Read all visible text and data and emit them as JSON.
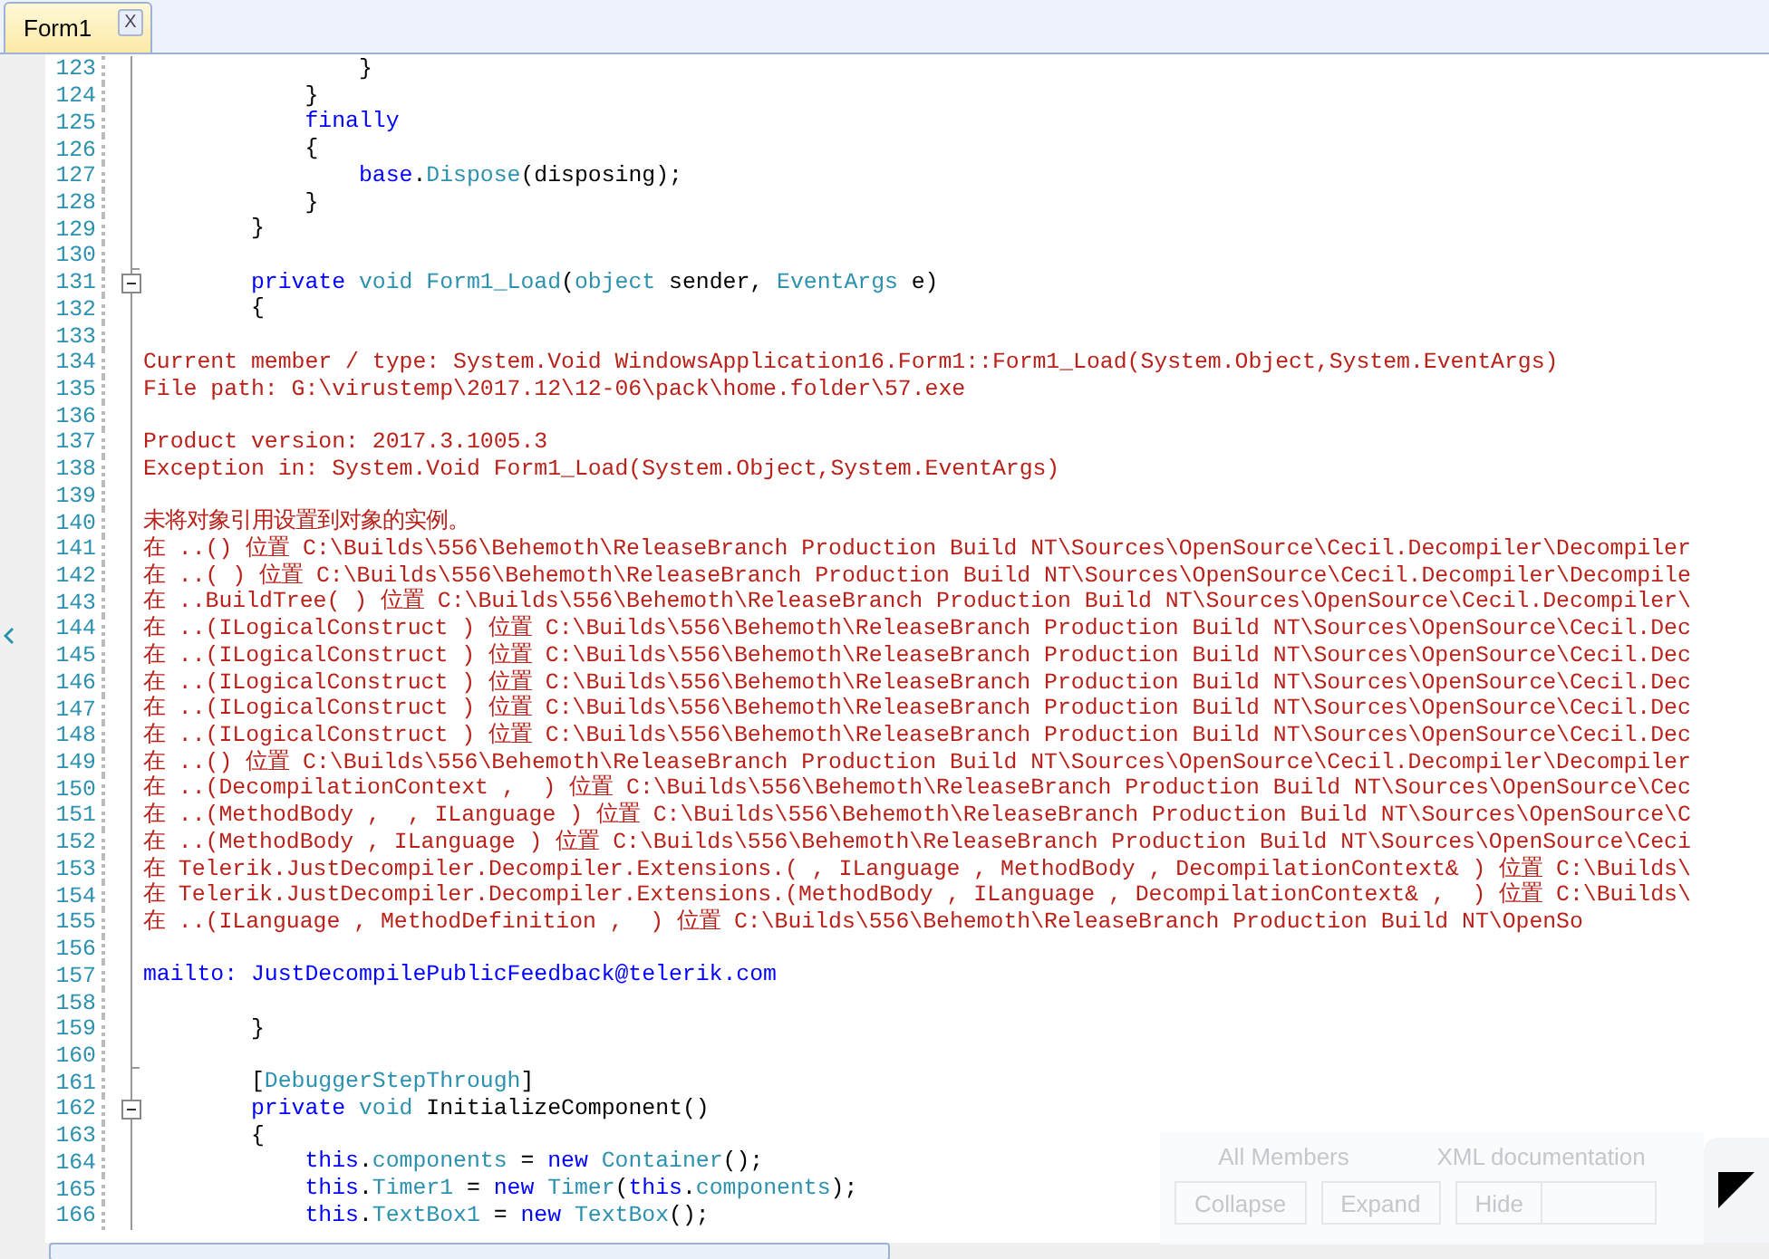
{
  "tabs": [
    {
      "label": "Form1",
      "selected": true,
      "close": "X"
    }
  ],
  "lines": [
    {
      "number": "123",
      "segments": [
        {
          "kind": "text",
          "text": "                }"
        }
      ]
    },
    {
      "number": "124",
      "segments": [
        {
          "kind": "text",
          "text": "            }"
        }
      ]
    },
    {
      "number": "125",
      "segments": [
        {
          "kind": "keyword",
          "text": "            finally"
        }
      ]
    },
    {
      "number": "126",
      "segments": [
        {
          "kind": "text",
          "text": "            {"
        }
      ]
    },
    {
      "number": "127",
      "segments": [
        {
          "kind": "keyword",
          "text": "                base"
        },
        {
          "kind": "text",
          "text": "."
        },
        {
          "kind": "type",
          "text": "Dispose"
        },
        {
          "kind": "text",
          "text": "(disposing);"
        }
      ]
    },
    {
      "number": "128",
      "segments": [
        {
          "kind": "text",
          "text": "            }"
        }
      ]
    },
    {
      "number": "129",
      "segments": [
        {
          "kind": "text",
          "text": "        }"
        }
      ]
    },
    {
      "number": "130",
      "kind": "foldend"
    },
    {
      "number": "131",
      "kind": "foldstart",
      "expanded": true,
      "segments": [
        {
          "kind": "keyword",
          "text": "        private"
        },
        {
          "kind": "type",
          "text": " void Form1_Load"
        },
        {
          "kind": "text",
          "text": "("
        },
        {
          "kind": "type",
          "text": "object"
        },
        {
          "kind": "text",
          "text": " sender, "
        },
        {
          "kind": "type",
          "text": "EventArgs"
        },
        {
          "kind": "text",
          "text": " e)"
        }
      ]
    },
    {
      "number": "132",
      "segments": [
        {
          "kind": "text",
          "text": "        {"
        }
      ]
    },
    {
      "number": "133"
    },
    {
      "number": "134",
      "segments": [
        {
          "kind": "message",
          "text": "Current member / type: System.Void WindowsApplication16.Form1::Form1_Load(System.Object,System.EventArgs)"
        }
      ]
    },
    {
      "number": "135",
      "segments": [
        {
          "kind": "message",
          "text": "File path: G:\\virustemp\\2017.12\\12-06\\pack\\home.folder\\57.exe"
        }
      ]
    },
    {
      "number": "136"
    },
    {
      "number": "137",
      "segments": [
        {
          "kind": "message",
          "text": "Product version: 2017.3.1005.3"
        }
      ]
    },
    {
      "number": "138",
      "segments": [
        {
          "kind": "message",
          "text": "Exception in: System.Void Form1_Load(System.Object,System.EventArgs)"
        }
      ]
    },
    {
      "number": "139"
    },
    {
      "number": "140",
      "segments": [
        {
          "kind": "message",
          "text": "未将对象引用设置到对象的实例。"
        }
      ]
    },
    {
      "number": "141",
      "segments": [
        {
          "kind": "message",
          "text": "在 ..() 位置 C:\\Builds\\556\\Behemoth\\ReleaseBranch Production Build NT\\Sources\\OpenSource\\Cecil.Decompiler\\Decompiler"
        }
      ]
    },
    {
      "number": "142",
      "segments": [
        {
          "kind": "message",
          "text": "在 ..( ) 位置 C:\\Builds\\556\\Behemoth\\ReleaseBranch Production Build NT\\Sources\\OpenSource\\Cecil.Decompiler\\Decompile"
        }
      ]
    },
    {
      "number": "143",
      "segments": [
        {
          "kind": "message",
          "text": "在 ..BuildTree( ) 位置 C:\\Builds\\556\\Behemoth\\ReleaseBranch Production Build NT\\Sources\\OpenSource\\Cecil.Decompiler\\"
        }
      ]
    },
    {
      "number": "144",
      "segments": [
        {
          "kind": "message",
          "text": "在 ..(ILogicalConstruct ) 位置 C:\\Builds\\556\\Behemoth\\ReleaseBranch Production Build NT\\Sources\\OpenSource\\Cecil.Dec"
        }
      ]
    },
    {
      "number": "145",
      "segments": [
        {
          "kind": "message",
          "text": "在 ..(ILogicalConstruct ) 位置 C:\\Builds\\556\\Behemoth\\ReleaseBranch Production Build NT\\Sources\\OpenSource\\Cecil.Dec"
        }
      ]
    },
    {
      "number": "146",
      "segments": [
        {
          "kind": "message",
          "text": "在 ..(ILogicalConstruct ) 位置 C:\\Builds\\556\\Behemoth\\ReleaseBranch Production Build NT\\Sources\\OpenSource\\Cecil.Dec"
        }
      ]
    },
    {
      "number": "147",
      "segments": [
        {
          "kind": "message",
          "text": "在 ..(ILogicalConstruct ) 位置 C:\\Builds\\556\\Behemoth\\ReleaseBranch Production Build NT\\Sources\\OpenSource\\Cecil.Dec"
        }
      ]
    },
    {
      "number": "148",
      "segments": [
        {
          "kind": "message",
          "text": "在 ..(ILogicalConstruct ) 位置 C:\\Builds\\556\\Behemoth\\ReleaseBranch Production Build NT\\Sources\\OpenSource\\Cecil.Dec"
        }
      ]
    },
    {
      "number": "149",
      "segments": [
        {
          "kind": "message",
          "text": "在 ..() 位置 C:\\Builds\\556\\Behemoth\\ReleaseBranch Production Build NT\\Sources\\OpenSource\\Cecil.Decompiler\\Decompiler"
        }
      ]
    },
    {
      "number": "150",
      "segments": [
        {
          "kind": "message",
          "text": "在 ..(DecompilationContext ,  ) 位置 C:\\Builds\\556\\Behemoth\\ReleaseBranch Production Build NT\\Sources\\OpenSource\\Cec"
        }
      ]
    },
    {
      "number": "151",
      "segments": [
        {
          "kind": "message",
          "text": "在 ..(MethodBody ,  , ILanguage ) 位置 C:\\Builds\\556\\Behemoth\\ReleaseBranch Production Build NT\\Sources\\OpenSource\\C"
        }
      ]
    },
    {
      "number": "152",
      "segments": [
        {
          "kind": "message",
          "text": "在 ..(MethodBody , ILanguage ) 位置 C:\\Builds\\556\\Behemoth\\ReleaseBranch Production Build NT\\Sources\\OpenSource\\Ceci"
        }
      ]
    },
    {
      "number": "153",
      "segments": [
        {
          "kind": "message",
          "text": "在 Telerik.JustDecompiler.Decompiler.Extensions.( , ILanguage , MethodBody , DecompilationContext& ) 位置 C:\\Builds\\"
        }
      ]
    },
    {
      "number": "154",
      "segments": [
        {
          "kind": "message",
          "text": "在 Telerik.JustDecompiler.Decompiler.Extensions.(MethodBody , ILanguage , DecompilationContext& ,  ) 位置 C:\\Builds\\"
        }
      ]
    },
    {
      "number": "155",
      "segments": [
        {
          "kind": "message",
          "text": "在 ..(ILanguage , MethodDefinition ,  ) 位置 C:\\Builds\\556\\Behemoth\\ReleaseBranch Production Build NT\\OpenSo"
        }
      ]
    },
    {
      "number": "156"
    },
    {
      "number": "157",
      "segments": [
        {
          "kind": "link",
          "text": "mailto: JustDecompilePublicFeedback@telerik.com"
        }
      ]
    },
    {
      "number": "158"
    },
    {
      "number": "159",
      "segments": [
        {
          "kind": "text",
          "text": "        }"
        }
      ]
    },
    {
      "number": "160",
      "kind": "foldend"
    },
    {
      "number": "161",
      "segments": [
        {
          "kind": "text",
          "text": "        ["
        },
        {
          "kind": "type",
          "text": "DebuggerStepThrough"
        },
        {
          "kind": "text",
          "text": "]"
        }
      ]
    },
    {
      "number": "162",
      "kind": "foldstart",
      "expanded": true,
      "segments": [
        {
          "kind": "keyword",
          "text": "        private"
        },
        {
          "kind": "type",
          "text": " void"
        },
        {
          "kind": "text",
          "text": " InitializeComponent()"
        }
      ]
    },
    {
      "number": "163",
      "segments": [
        {
          "kind": "text",
          "text": "        {"
        }
      ]
    },
    {
      "number": "164",
      "segments": [
        {
          "kind": "keyword",
          "text": "            this"
        },
        {
          "kind": "text",
          "text": "."
        },
        {
          "kind": "type",
          "text": "components"
        },
        {
          "kind": "text",
          "text": " = "
        },
        {
          "kind": "keyword",
          "text": "new"
        },
        {
          "kind": "type",
          "text": " Container"
        },
        {
          "kind": "text",
          "text": "();"
        }
      ]
    },
    {
      "number": "165",
      "segments": [
        {
          "kind": "keyword",
          "text": "            this"
        },
        {
          "kind": "text",
          "text": "."
        },
        {
          "kind": "type",
          "text": "Timer1"
        },
        {
          "kind": "text",
          "text": " = "
        },
        {
          "kind": "keyword",
          "text": "new"
        },
        {
          "kind": "type",
          "text": " Timer"
        },
        {
          "kind": "text",
          "text": "("
        },
        {
          "kind": "keyword",
          "text": "this"
        },
        {
          "kind": "text",
          "text": "."
        },
        {
          "kind": "type",
          "text": "components"
        },
        {
          "kind": "text",
          "text": ");"
        }
      ]
    },
    {
      "number": "166",
      "segments": [
        {
          "kind": "keyword",
          "text": "            this"
        },
        {
          "kind": "text",
          "text": "."
        },
        {
          "kind": "type",
          "text": "TextBox1"
        },
        {
          "kind": "text",
          "text": " = "
        },
        {
          "kind": "keyword",
          "text": "new"
        },
        {
          "kind": "type",
          "text": " TextBox"
        },
        {
          "kind": "text",
          "text": "();"
        }
      ]
    }
  ],
  "panel": {
    "tabs": [
      {
        "label": "All Members"
      },
      {
        "label": "XML documentation"
      }
    ],
    "buttons": [
      {
        "label": "Collapse"
      },
      {
        "label": "Expand"
      },
      {
        "label": "Hide"
      }
    ]
  }
}
